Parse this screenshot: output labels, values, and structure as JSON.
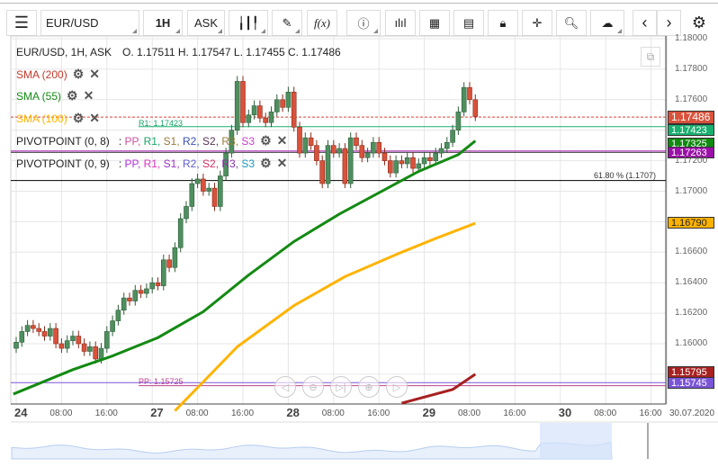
{
  "toolbar": {
    "symbol": "EUR/USD",
    "timeframe": "1H",
    "side": "ASK",
    "buttons": [
      "menu",
      "chart-type",
      "draw",
      "function",
      "info",
      "indicators",
      "calendar",
      "news",
      "lock",
      "crosshair",
      "zoom",
      "upload",
      "prev",
      "next",
      "settings"
    ]
  },
  "legend": {
    "header": "EUR/USD, 1H, ASK",
    "ohlc": "O. 1.17511 H. 1.17547 L. 1.17455 C. 1.17486",
    "sma200": "SMA (200)",
    "sma55": "SMA (55)",
    "sma100": "SMA (100)",
    "pivot1": "PIVOTPOINT (0, 8)",
    "pivot2": "PIVOTPOINT (0, 9)",
    "pivot1_items": [
      {
        "t": "PP",
        "c": "#d04fa0"
      },
      {
        "t": "R1",
        "c": "#19a36a"
      },
      {
        "t": "S1",
        "c": "#9a7b3a"
      },
      {
        "t": "R2",
        "c": "#3b4fb0"
      },
      {
        "t": "S2",
        "c": "#553355"
      },
      {
        "t": "R3",
        "c": "#9a7b3a"
      },
      {
        "t": "S3",
        "c": "#c83fd0"
      }
    ],
    "pivot2_items": [
      {
        "t": "PP",
        "c": "#b030e0"
      },
      {
        "t": "R1",
        "c": "#e030c0"
      },
      {
        "t": "S1",
        "c": "#9a30c0"
      },
      {
        "t": "R2",
        "c": "#6060d0"
      },
      {
        "t": "S2",
        "c": "#d03060"
      },
      {
        "t": "R3",
        "c": "#8a30b0"
      },
      {
        "t": "S3",
        "c": "#1a9ac0"
      }
    ]
  },
  "annotations": {
    "r1": "R1: 1.17423",
    "pp": "PP: 1.15725",
    "fib": "61.80 % (1.1707)"
  },
  "price_tags": [
    {
      "v": "1.17486",
      "p": 1.17486,
      "c": "#d9523b"
    },
    {
      "v": "1.17423",
      "p": 1.17423,
      "c": "#19b070"
    },
    {
      "v": "1.17325",
      "p": 1.17325,
      "c": "#0f8a0f"
    },
    {
      "v": "1.17263",
      "p": 1.17263,
      "c": "#9b10a8"
    },
    {
      "v": "1.16790",
      "p": 1.1679,
      "c": "#ffb300"
    },
    {
      "v": "1.15795",
      "p": 1.15795,
      "c": "#a82020"
    },
    {
      "v": "1.15745",
      "p": 1.15745,
      "c": "#7a55d8"
    }
  ],
  "chart_data": {
    "type": "candlestick",
    "symbol": "EUR/USD",
    "interval": "1H",
    "y_ticks": [
      "1.18000",
      "1.17800",
      "1.17600",
      "1.17200",
      "1.17000",
      "1.16600",
      "1.16400",
      "1.16200",
      "1.16000"
    ],
    "ylim": [
      1.155,
      1.1803
    ],
    "x_days": [
      {
        "label": "24",
        "i": 0
      },
      {
        "label": "27",
        "i": 24
      },
      {
        "label": "28",
        "i": 48
      },
      {
        "label": "29",
        "i": 72
      },
      {
        "label": "30",
        "i": 96
      }
    ],
    "x_hours": [
      {
        "label": "08:00",
        "i": 8
      },
      {
        "label": "16:00",
        "i": 16
      },
      {
        "label": "08:00",
        "i": 32
      },
      {
        "label": "16:00",
        "i": 40
      },
      {
        "label": "08:00",
        "i": 56
      },
      {
        "label": "16:00",
        "i": 64
      },
      {
        "label": "08:00",
        "i": 80
      },
      {
        "label": "16:00",
        "i": 88
      },
      {
        "label": "08:00",
        "i": 104
      },
      {
        "label": "16:00",
        "i": 112
      }
    ],
    "x_end_label": "30.07.2020",
    "closes": [
      1.1601,
      1.1608,
      1.1612,
      1.161,
      1.1608,
      1.1605,
      1.161,
      1.16,
      1.1597,
      1.1602,
      1.1605,
      1.16,
      1.1595,
      1.1598,
      1.159,
      1.1597,
      1.1608,
      1.1615,
      1.1622,
      1.163,
      1.1628,
      1.1635,
      1.1633,
      1.1636,
      1.164,
      1.1638,
      1.1655,
      1.165,
      1.1663,
      1.1682,
      1.169,
      1.1705,
      1.1708,
      1.17,
      1.1702,
      1.169,
      1.171,
      1.1725,
      1.174,
      1.1772,
      1.1745,
      1.175,
      1.1756,
      1.1748,
      1.1745,
      1.1752,
      1.176,
      1.1755,
      1.1765,
      1.1742,
      1.1725,
      1.1735,
      1.173,
      1.172,
      1.1705,
      1.173,
      1.1725,
      1.1728,
      1.1705,
      1.1735,
      1.173,
      1.1722,
      1.1725,
      1.1732,
      1.1725,
      1.172,
      1.1712,
      1.172,
      1.1718,
      1.1722,
      1.1715,
      1.1718,
      1.1722,
      1.172,
      1.1725,
      1.1728,
      1.1732,
      1.174,
      1.1752,
      1.1768,
      1.176,
      1.1749
    ],
    "series": [
      {
        "name": "SMA (55)",
        "color": "#138a13",
        "points": [
          [
            -0.5,
            1.1567
          ],
          [
            10,
            1.1583
          ],
          [
            17,
            1.1592
          ],
          [
            25,
            1.1604
          ],
          [
            33,
            1.1621
          ],
          [
            41,
            1.1645
          ],
          [
            49,
            1.1667
          ],
          [
            57,
            1.1685
          ],
          [
            65,
            1.1701
          ],
          [
            71,
            1.1713
          ],
          [
            78,
            1.1724
          ],
          [
            81,
            1.1733
          ]
        ]
      },
      {
        "name": "SMA (100)",
        "color": "#ffb300",
        "points": [
          [
            28,
            1.1556
          ],
          [
            33,
            1.1575
          ],
          [
            39,
            1.1598
          ],
          [
            49,
            1.1625
          ],
          [
            58,
            1.1644
          ],
          [
            68,
            1.166
          ],
          [
            74,
            1.1669
          ],
          [
            81,
            1.1679
          ]
        ]
      },
      {
        "name": "SMA (200)",
        "color": "#a82020",
        "points": [
          [
            68,
            1.1561
          ],
          [
            77,
            1.157
          ],
          [
            81,
            1.158
          ]
        ]
      }
    ],
    "levels": [
      {
        "name": "last",
        "p": 1.17486,
        "color": "#e04030",
        "dash": true
      },
      {
        "name": "R1",
        "p": 1.17423,
        "color": "#19b070"
      },
      {
        "name": "pivot",
        "p": 1.17263,
        "color": "#9b10a8"
      },
      {
        "name": "fib",
        "p": 1.1707,
        "color": "#000"
      },
      {
        "name": "PP2",
        "p": 1.15745,
        "color": "#7a55d8"
      },
      {
        "name": "PP",
        "p": 1.15725,
        "color": "#c04090"
      }
    ]
  }
}
